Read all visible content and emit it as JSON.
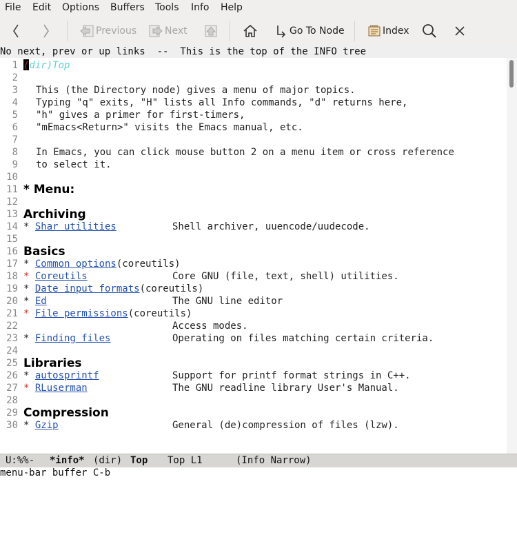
{
  "menubar": [
    "File",
    "Edit",
    "Options",
    "Buffers",
    "Tools",
    "Info",
    "Help"
  ],
  "toolbar": {
    "previous_label": "Previous",
    "next_label": "Next",
    "goto_node_label": "Go To Node",
    "index_label": "Index",
    "icons": [
      "back-arrow-icon",
      "forward-arrow-icon",
      "previous-node-icon",
      "next-node-icon",
      "up-node-icon",
      "home-icon",
      "goto-node-icon",
      "index-icon",
      "search-icon",
      "close-icon"
    ]
  },
  "header_line": "No next, prev or up links  --  This is the top of the INFO tree",
  "buffer": {
    "first_line": {
      "num": "1",
      "node_label": "(dir)Top"
    },
    "intro_lines": [
      {
        "num": "2",
        "text": ""
      },
      {
        "num": "3",
        "text": "This (the Directory node) gives a menu of major topics."
      },
      {
        "num": "4",
        "text": "Typing \"q\" exits, \"H\" lists all Info commands, \"d\" returns here,"
      },
      {
        "num": "5",
        "text": "\"h\" gives a primer for first-timers,"
      },
      {
        "num": "6",
        "text": "\"mEmacs<Return>\" visits the Emacs manual, etc."
      },
      {
        "num": "7",
        "text": ""
      },
      {
        "num": "8",
        "text": "In Emacs, you can click mouse button 2 on a menu item or cross reference"
      },
      {
        "num": "9",
        "text": "to select it."
      },
      {
        "num": "10",
        "text": ""
      }
    ],
    "menu_line": {
      "num": "11",
      "text": "* Menu:"
    },
    "sections": [
      {
        "blank_num": "12",
        "heading_num": "13",
        "heading": "Archiving",
        "entries": [
          {
            "num": "14",
            "bullet_red": false,
            "name": "Shar utilities",
            "suffix": "",
            "desc": "Shell archiver, uuencode/uudecode."
          }
        ]
      },
      {
        "blank_num": "15",
        "heading_num": "16",
        "heading": "Basics",
        "entries": [
          {
            "num": "17",
            "bullet_red": false,
            "name": "Common options",
            "suffix": "(coreutils)",
            "desc": ""
          },
          {
            "num": "18",
            "bullet_red": true,
            "name": "Coreutils",
            "suffix": "",
            "desc": "Core GNU (file, text, shell) utilities."
          },
          {
            "num": "19",
            "bullet_red": false,
            "name": "Date input formats",
            "suffix": "(coreutils)",
            "desc": ""
          },
          {
            "num": "20",
            "bullet_red": false,
            "name": "Ed",
            "suffix": "",
            "desc": "The GNU line editor"
          },
          {
            "num": "21",
            "bullet_red": true,
            "name": "File permissions",
            "suffix": "(coreutils)",
            "desc": ""
          },
          {
            "num": "22",
            "continuation": true,
            "desc": "Access modes."
          },
          {
            "num": "23",
            "bullet_red": false,
            "name": "Finding files",
            "suffix": "",
            "desc": "Operating on files matching certain criteria."
          }
        ]
      },
      {
        "blank_num": "24",
        "heading_num": "25",
        "heading": "Libraries",
        "entries": [
          {
            "num": "26",
            "bullet_red": false,
            "name": "autosprintf",
            "suffix": "",
            "desc": "Support for printf format strings in C++."
          },
          {
            "num": "27",
            "bullet_red": true,
            "name": "RLuserman",
            "suffix": "",
            "desc": "The GNU readline library User's Manual."
          }
        ]
      },
      {
        "blank_num": "28",
        "heading_num": "29",
        "heading": "Compression",
        "entries": [
          {
            "num": "30",
            "bullet_red": false,
            "name": "Gzip",
            "suffix": "",
            "desc": "General (de)compression of files (lzw)."
          }
        ]
      }
    ]
  },
  "modeline": {
    "status": "U:%%-",
    "buffer_name": "*info*",
    "file": "(dir)",
    "node": "Top",
    "position": "Top L1",
    "modes": "(Info Narrow)"
  },
  "echo_area": "menu-bar buffer C-b",
  "colors": {
    "link": "#2552b0",
    "red_bullet": "#d4302a",
    "node_name": "#a0302c",
    "toolbar_bg": "#f0efee",
    "modeline_bg": "#d7d6d3"
  }
}
